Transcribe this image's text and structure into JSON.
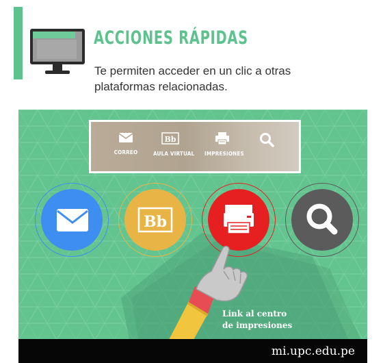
{
  "header": {
    "title": "ACCIONES RÁPIDAS",
    "subtitle": "Te permiten acceder en un clic a otras plataformas relacionadas.",
    "accent_color": "#5ec28e",
    "icon": "monitor-icon"
  },
  "toolbar": {
    "items": [
      {
        "label": "CORREO",
        "icon": "mail-icon"
      },
      {
        "label": "AULA VIRTUAL",
        "icon": "blackboard-icon"
      },
      {
        "label": "IMPRESIONES",
        "icon": "printer-icon"
      },
      {
        "label": "",
        "icon": "search-icon"
      }
    ]
  },
  "circles": [
    {
      "name": "mail",
      "color": "#3e8df0",
      "icon": "mail-icon"
    },
    {
      "name": "aula-virtual",
      "color": "#e8b445",
      "icon": "blackboard-icon",
      "icon_text": "Bb"
    },
    {
      "name": "impresiones",
      "color": "#e62020",
      "icon": "printer-icon"
    },
    {
      "name": "buscar",
      "color": "#5b5b5b",
      "icon": "search-icon"
    }
  ],
  "callout": {
    "line1": "Link al centro",
    "line2": "de impresiones"
  },
  "footer": {
    "url": "mi.upc.edu.pe"
  },
  "colors": {
    "panel_background": "#63c490",
    "footer_background": "#060606"
  }
}
